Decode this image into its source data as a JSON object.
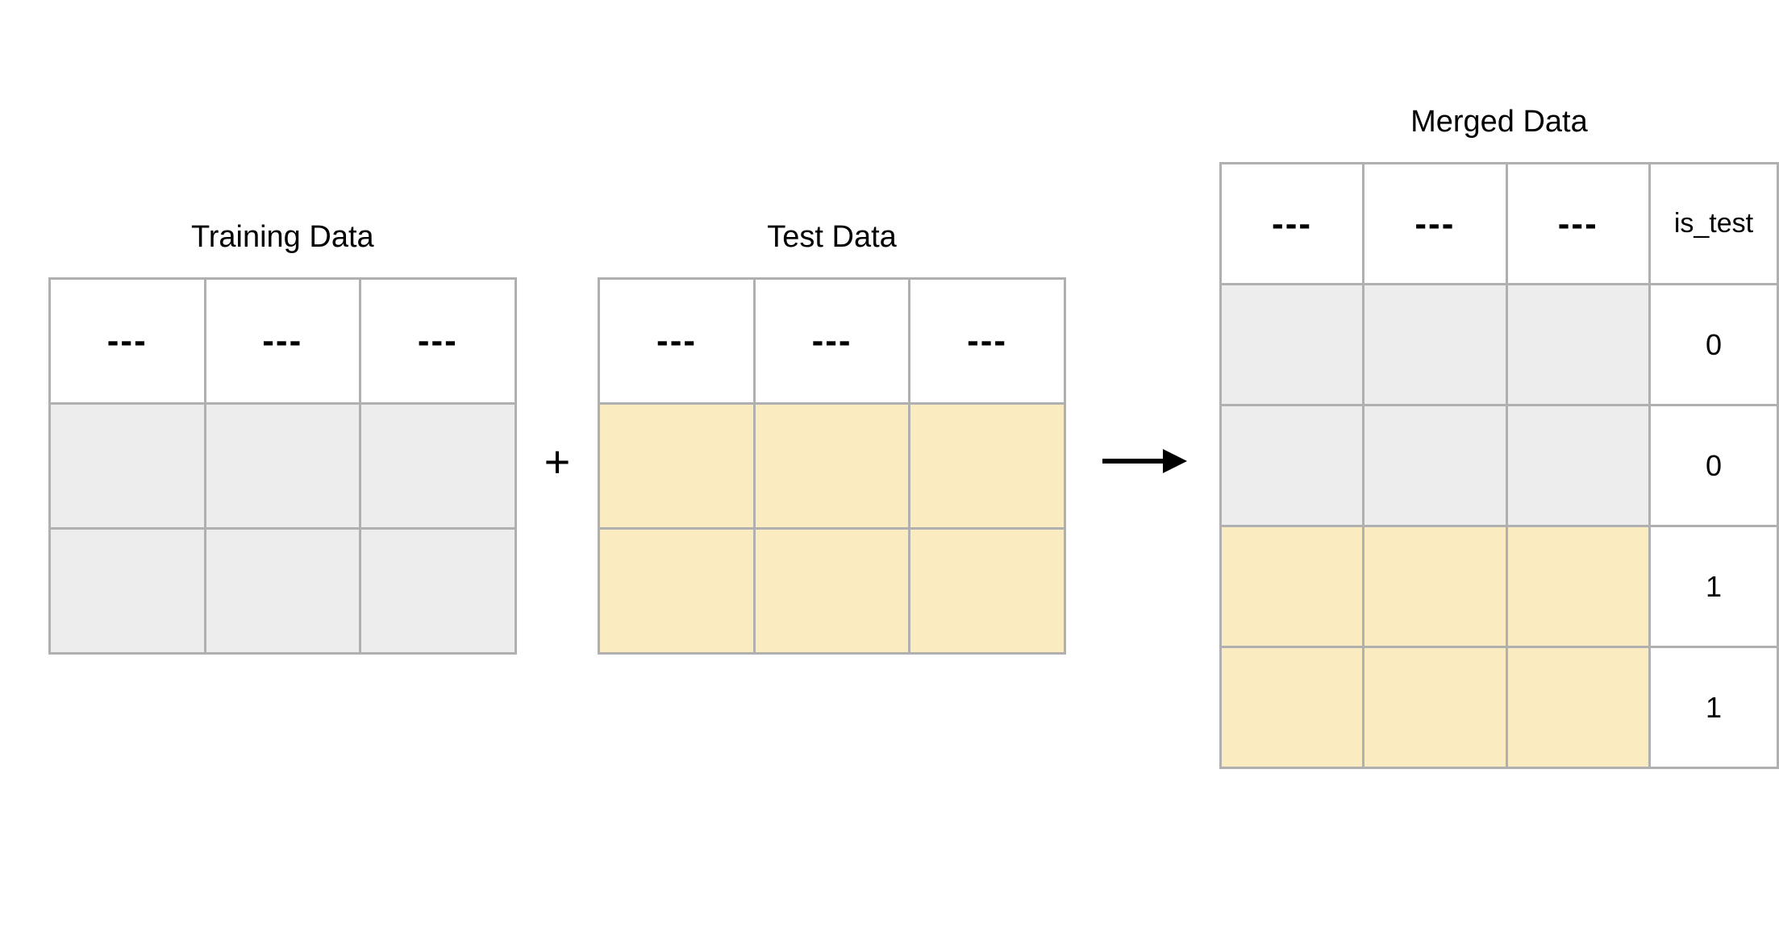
{
  "diagram": {
    "training": {
      "title": "Training Data",
      "headers": [
        "---",
        "---",
        "---"
      ],
      "rows": 2,
      "cols": 3,
      "cell_color": "gray"
    },
    "test": {
      "title": "Test Data",
      "headers": [
        "---",
        "---",
        "---"
      ],
      "rows": 2,
      "cols": 3,
      "cell_color": "yellow"
    },
    "merged": {
      "title": "Merged Data",
      "headers": [
        "---",
        "---",
        "---"
      ],
      "extra_header": "is_test",
      "rows": [
        {
          "color": "gray",
          "is_test": "0"
        },
        {
          "color": "gray",
          "is_test": "0"
        },
        {
          "color": "yellow",
          "is_test": "1"
        },
        {
          "color": "yellow",
          "is_test": "1"
        }
      ]
    },
    "operators": {
      "plus": "+",
      "arrow": "→"
    }
  }
}
